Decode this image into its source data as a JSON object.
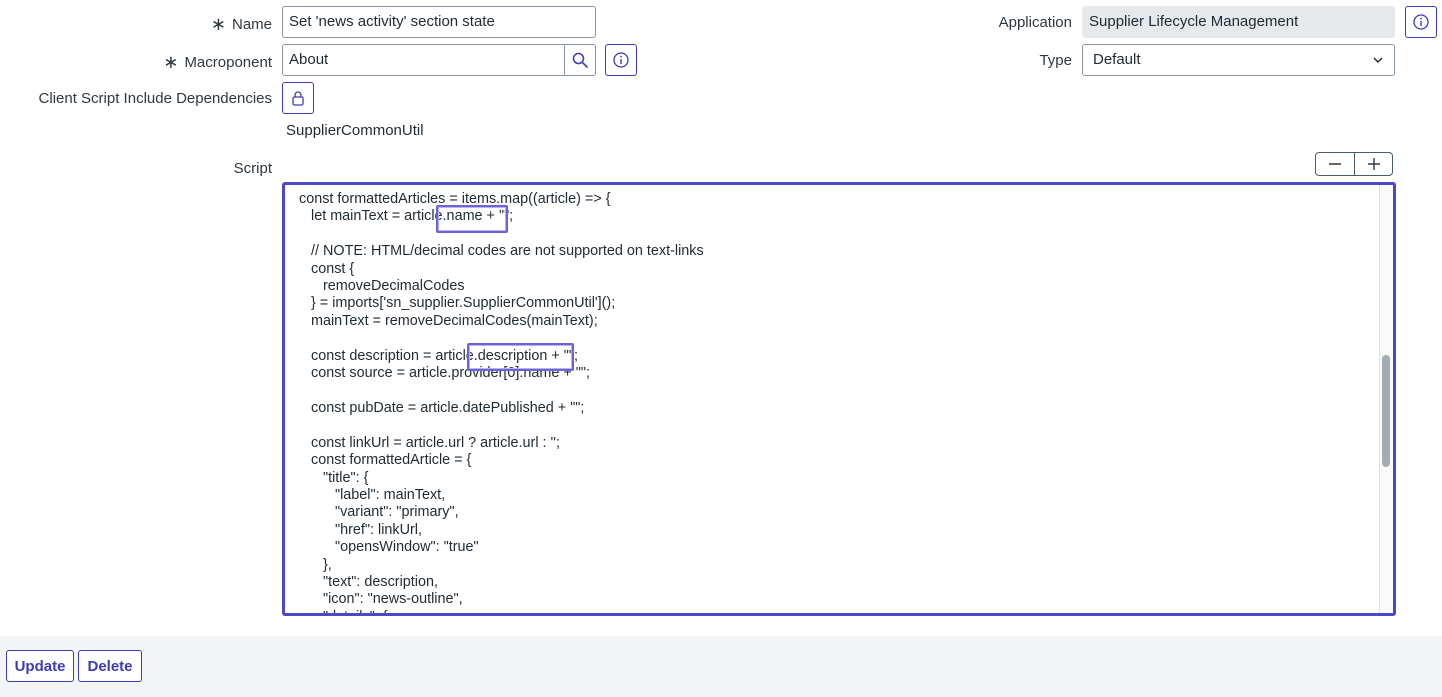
{
  "form": {
    "name_label": "Name",
    "name_value": "Set 'news activity' section state",
    "macroponent_label": "Macroponent",
    "macroponent_value": "About",
    "dependencies_label": "Client Script Include Dependencies",
    "dependency_value": "SupplierCommonUtil",
    "application_label": "Application",
    "application_value": "Supplier Lifecycle Management",
    "type_label": "Type",
    "type_value": "Default",
    "script_label": "Script",
    "required_marker": "∗"
  },
  "editor": {
    "lines": [
      "const formattedArticles = items.map((article) => {",
      "   let mainText = article.name + \"\";",
      "",
      "   // NOTE: HTML/decimal codes are not supported on text-links",
      "   const {",
      "      removeDecimalCodes",
      "   } = imports['sn_supplier.SupplierCommonUtil']();",
      "   mainText = removeDecimalCodes(mainText);",
      "",
      "   const description = article.description + \"\";",
      "   const source = article.provider[0].name + \"\";",
      "",
      "   const pubDate = article.datePublished + \"\";",
      "",
      "   const linkUrl = article.url ? article.url : '';",
      "   const formattedArticle = {",
      "      \"title\": {",
      "         \"label\": mainText,",
      "         \"variant\": \"primary\",",
      "         \"href\": linkUrl,",
      "         \"opensWindow\": \"true\"",
      "      },",
      "      \"text\": description,",
      "      \"icon\": \"news-outline\",",
      "      \"details\": {"
    ]
  },
  "icons": {
    "search": "search-icon",
    "info": "info-icon",
    "lock": "lock-icon",
    "minus": "minus-icon",
    "plus": "plus-icon",
    "dropdown": "chevron-down-icon"
  },
  "footer": {
    "update_label": "Update",
    "delete_label": "Delete"
  },
  "colors": {
    "accent": "#3d3cb4",
    "highlight": "#6b63d8"
  }
}
